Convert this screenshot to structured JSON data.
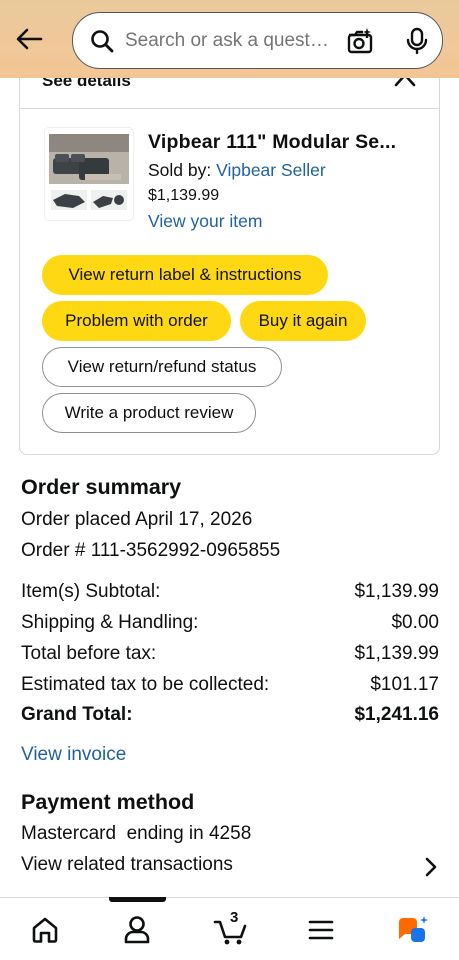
{
  "header": {
    "back_label": "Back",
    "search_placeholder": "Search or ask a question"
  },
  "order_card": {
    "see_details": "See details",
    "product": {
      "title": "Vipbear 111\" Modular Se...",
      "sold_by_prefix": "Sold by: ",
      "seller": "Vipbear Seller",
      "price": "$1,139.99",
      "view_item": "View your item"
    },
    "actions": {
      "return_label": "View return label & instructions",
      "problem": "Problem with order",
      "buy_again": "Buy it again",
      "refund_status": "View return/refund status",
      "review": "Write a product review"
    }
  },
  "order_summary": {
    "title": "Order summary",
    "placed": "Order placed April 17, 2026",
    "order_number": "Order # 111-3562992-0965855",
    "rows": [
      {
        "label": "Item(s) Subtotal:",
        "value": "$1,139.99"
      },
      {
        "label": "Shipping & Handling:",
        "value": "$0.00"
      },
      {
        "label": "Total before tax:",
        "value": "$1,139.99"
      },
      {
        "label": "Estimated tax to be collected:",
        "value": "$101.17"
      },
      {
        "label": "Grand Total:",
        "value": "$1,241.16"
      }
    ],
    "view_invoice": "View invoice"
  },
  "payment": {
    "title": "Payment method",
    "card": "Mastercard  ending in 4258",
    "related": "View related transactions"
  },
  "bottom_nav": {
    "cart_count": "3",
    "items": [
      "home-icon",
      "account-icon",
      "cart-icon",
      "menu-icon",
      "rufus-icon"
    ]
  },
  "colors": {
    "header_bg": "#f0c89a",
    "link": "#2162a1",
    "button_yellow": "#ffd814",
    "rufus_orange": "#ff6a00",
    "rufus_blue": "#1a73e8"
  }
}
